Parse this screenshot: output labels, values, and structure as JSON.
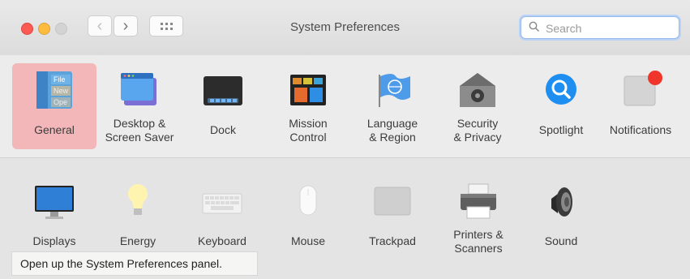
{
  "window": {
    "title": "System Preferences"
  },
  "toolbar": {
    "back_symbol": "‹",
    "forward_symbol": "›",
    "grid_icon": "grid-view-icon"
  },
  "search": {
    "placeholder": "Search",
    "icon": "magnifying-glass-icon"
  },
  "row1": [
    {
      "id": "general",
      "label": "General",
      "icon": "general-icon",
      "selected": true,
      "icon_text": [
        "File",
        "New",
        "Ope"
      ]
    },
    {
      "id": "desktop",
      "label": "Desktop &\nScreen Saver",
      "icon": "desktop-screensaver-icon"
    },
    {
      "id": "dock",
      "label": "Dock",
      "icon": "dock-icon"
    },
    {
      "id": "mission",
      "label": "Mission\nControl",
      "icon": "mission-control-icon"
    },
    {
      "id": "language",
      "label": "Language\n& Region",
      "icon": "language-region-icon"
    },
    {
      "id": "security",
      "label": "Security\n& Privacy",
      "icon": "security-privacy-icon"
    },
    {
      "id": "spotlight",
      "label": "Spotlight",
      "icon": "spotlight-icon"
    },
    {
      "id": "notifications",
      "label": "Notifications",
      "icon": "notifications-icon"
    }
  ],
  "row2": [
    {
      "id": "displays",
      "label": "Displays",
      "icon": "displays-icon"
    },
    {
      "id": "energy",
      "label": "Energy",
      "icon": "energy-saver-icon"
    },
    {
      "id": "keyboard",
      "label": "Keyboard",
      "icon": "keyboard-icon"
    },
    {
      "id": "mouse",
      "label": "Mouse",
      "icon": "mouse-icon"
    },
    {
      "id": "trackpad",
      "label": "Trackpad",
      "icon": "trackpad-icon"
    },
    {
      "id": "printers",
      "label": "Printers &\nScanners",
      "icon": "printers-scanners-icon"
    },
    {
      "id": "sound",
      "label": "Sound",
      "icon": "sound-icon"
    }
  ],
  "caption": "Open up the System Preferences panel.",
  "colors": {
    "selected": "#f3b7b9",
    "close": "#fb5b53",
    "minimize": "#fdbb40",
    "spotlight": "#1e8ef0",
    "notification_dot": "#f0352c"
  }
}
